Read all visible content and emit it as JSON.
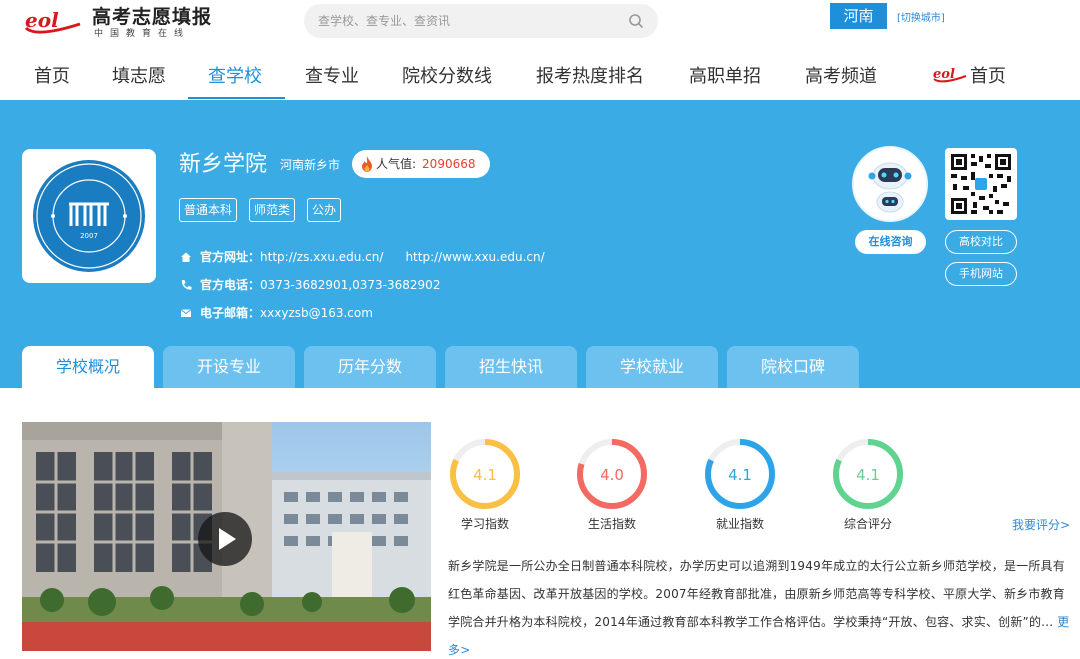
{
  "header": {
    "logo_title": "高考志愿填报",
    "logo_sub": "中国教育在线",
    "search_placeholder": "查学校、查专业、查资讯",
    "region": "河南",
    "switch_city": "[切换城市]"
  },
  "nav": {
    "items": [
      "首页",
      "填志愿",
      "查学校",
      "查专业",
      "院校分数线",
      "报考热度排名",
      "高职单招",
      "高考频道"
    ],
    "active_index": 2,
    "home_label": "首页"
  },
  "school": {
    "name": "新乡学院",
    "location": "河南新乡市",
    "popularity_label": "人气值:",
    "popularity_value": "2090668",
    "tags": [
      "普通本科",
      "师范类",
      "公办"
    ],
    "website_label": "官方网址：",
    "website_1": "http://zs.xxu.edu.cn/",
    "website_2": "http://www.xxu.edu.cn/",
    "phone_label": "官方电话：",
    "phone": "0373-3682901,0373-3682902",
    "email_label": "电子邮箱：",
    "email": "xxxyzsb@163.com",
    "logo_year": "2007"
  },
  "side": {
    "consult": "在线咨询",
    "compare": "高校对比",
    "mobile": "手机网站"
  },
  "tabs": [
    "学校概况",
    "开设专业",
    "历年分数",
    "招生快讯",
    "学校就业",
    "院校口碑"
  ],
  "ratings": [
    {
      "label": "学习指数",
      "value": "4.1",
      "score": 4.1,
      "color": "#f9c043"
    },
    {
      "label": "生活指数",
      "value": "4.0",
      "score": 4.0,
      "color": "#f26a61"
    },
    {
      "label": "就业指数",
      "value": "4.1",
      "score": 4.1,
      "color": "#2ea4e8"
    },
    {
      "label": "综合评分",
      "value": "4.1",
      "score": 4.1,
      "color": "#5fd38f"
    }
  ],
  "rate_link": "我要评分>",
  "description": "新乡学院是一所公办全日制普通本科院校，办学历史可以追溯到1949年成立的太行公立新乡师范学校，是一所具有红色革命基因、改革开放基因的学校。2007年经教育部批准，由原新乡师范高等专科学校、平原大学、新乡市教育学院合并升格为本科院校，2014年通过教育部本科教学工作合格评估。学校秉持“开放、包容、求实、创新”的...",
  "more": "更多>"
}
